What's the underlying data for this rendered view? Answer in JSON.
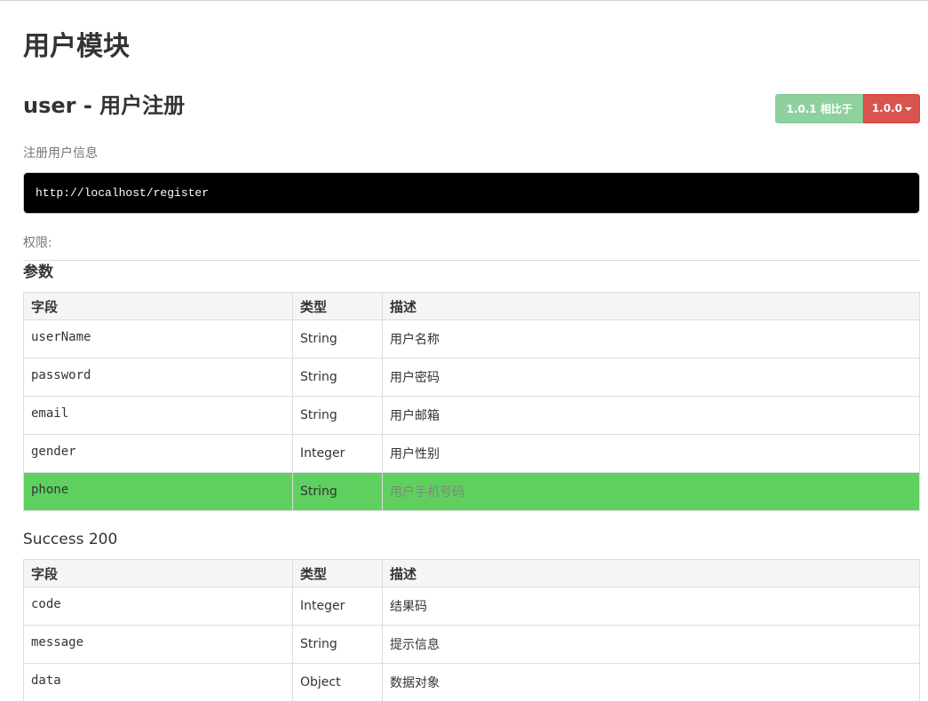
{
  "module": {
    "title": "用户模块"
  },
  "api": {
    "title": "user - 用户注册",
    "description": "注册用户信息",
    "url": "http://localhost/register",
    "permission_label": "权限:"
  },
  "version": {
    "compare_label": "1.0.1 相比于",
    "current": "1.0.0",
    "compare_color": "#8fd19e",
    "current_color": "#d9534f"
  },
  "params": {
    "title": "参数",
    "headers": [
      "字段",
      "类型",
      "描述"
    ],
    "rows": [
      {
        "field": "userName",
        "type": "String",
        "desc": "用户名称"
      },
      {
        "field": "password",
        "type": "String",
        "desc": "用户密码"
      },
      {
        "field": "email",
        "type": "String",
        "desc": "用户邮箱"
      },
      {
        "field": "gender",
        "type": "Integer",
        "desc": "用户性别"
      },
      {
        "field": "phone",
        "type": "String",
        "desc": "用户手机号码",
        "highlighted": true
      }
    ],
    "highlight_color": "#5fd060"
  },
  "success": {
    "title": "Success 200",
    "headers": [
      "字段",
      "类型",
      "描述"
    ],
    "rows": [
      {
        "field": "code",
        "type": "Integer",
        "desc": "结果码"
      },
      {
        "field": "message",
        "type": "String",
        "desc": "提示信息"
      },
      {
        "field": "data",
        "type": "Object",
        "desc": "数据对象"
      }
    ]
  }
}
